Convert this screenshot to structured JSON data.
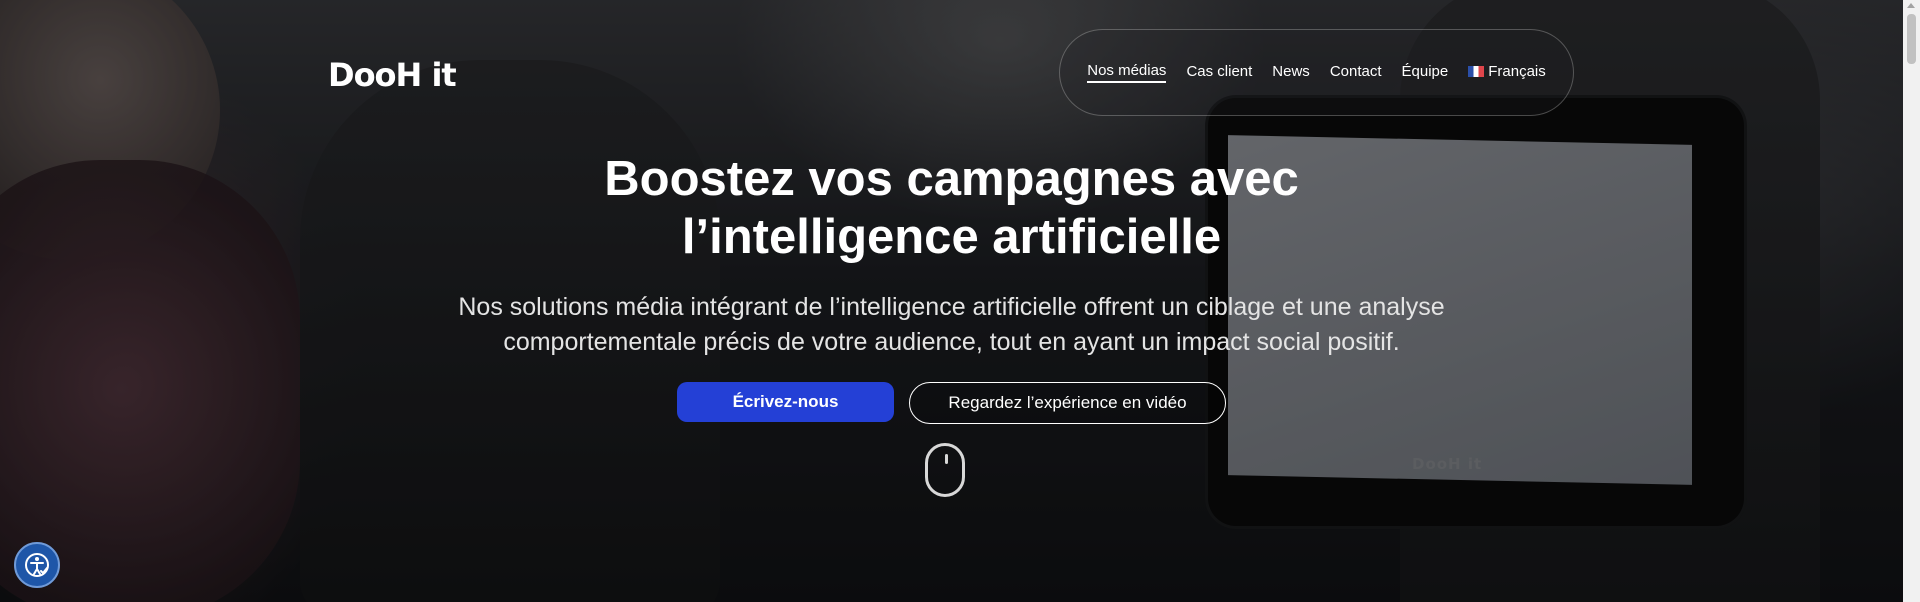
{
  "brand": {
    "logo_text": "DooH it"
  },
  "nav": {
    "items": [
      {
        "label": "Nos médias",
        "active": true
      },
      {
        "label": "Cas client"
      },
      {
        "label": "News"
      },
      {
        "label": "Contact"
      },
      {
        "label": "Équipe"
      },
      {
        "label": "Français",
        "icon": "french-flag-icon"
      }
    ]
  },
  "hero": {
    "headline_line1": "Boostez vos campagnes avec",
    "headline_line2": "l’intelligence artificielle",
    "subtitle_line1": "Nos solutions média intégrant de l’intelligence artificielle offrent un ciblage et une analyse",
    "subtitle_line2": "comportementale précis de votre audience, tout en ayant un impact social positif.",
    "cta_primary": "Écrivez-nous",
    "cta_secondary": "Regardez l’expérience en vidéo"
  },
  "scene": {
    "tablet_brand": "DooH it"
  },
  "colors": {
    "accent": "#2440d6",
    "a11y_widget": "#1e56a8"
  },
  "icons": {
    "scroll_indicator": "mouse-scroll-icon",
    "accessibility": "accessibility-icon"
  }
}
